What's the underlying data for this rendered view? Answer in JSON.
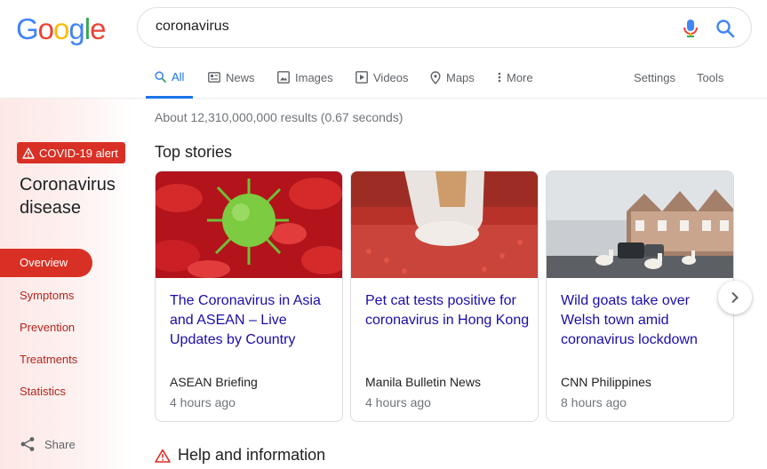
{
  "logo": [
    "G",
    "o",
    "o",
    "g",
    "l",
    "e"
  ],
  "logo_colors": [
    "#4285f4",
    "#ea4335",
    "#fbbc05",
    "#4285f4",
    "#34a853",
    "#ea4335"
  ],
  "search": {
    "query": "coronavirus"
  },
  "tabs": {
    "all": "All",
    "news": "News",
    "images": "Images",
    "videos": "Videos",
    "maps": "Maps",
    "more": "More",
    "settings": "Settings",
    "tools": "Tools"
  },
  "sidebar": {
    "alert": "COVID-19 alert",
    "title": "Coronavirus disease",
    "items": [
      "Overview",
      "Symptoms",
      "Prevention",
      "Treatments",
      "Statistics"
    ],
    "share": "Share"
  },
  "results": {
    "stats": "About 12,310,000,000 results (0.67 seconds)"
  },
  "top_stories": {
    "title": "Top stories",
    "cards": [
      {
        "headline": "The Coronavirus in Asia and ASEAN – Live Updates by Country",
        "source": "ASEAN Briefing",
        "time": "4 hours ago"
      },
      {
        "headline": "Pet cat tests positive for coronavirus in Hong Kong",
        "source": "Manila Bulletin News",
        "time": "4 hours ago"
      },
      {
        "headline": "Wild goats take over Welsh town amid coronavirus lockdown",
        "source": "CNN Philippines",
        "time": "8 hours ago"
      }
    ]
  },
  "help": {
    "title": "Help and information"
  },
  "colors": {
    "accent": "#1a73e8",
    "alert": "#d93025",
    "link": "#1a0dab"
  }
}
